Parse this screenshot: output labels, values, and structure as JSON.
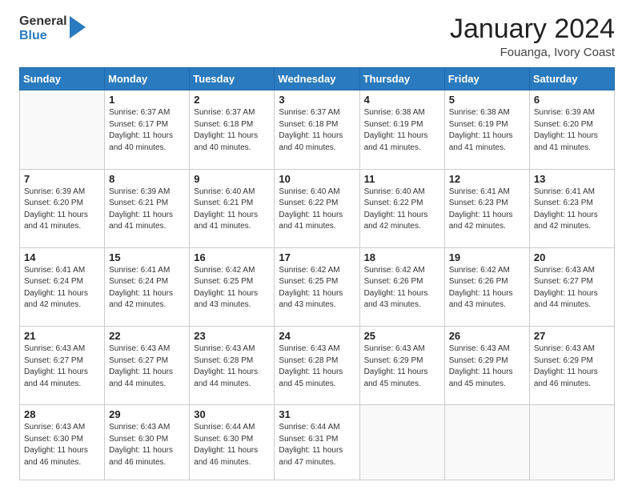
{
  "header": {
    "logo_line1": "General",
    "logo_line2": "Blue",
    "month": "January 2024",
    "location": "Fouanga, Ivory Coast"
  },
  "days_of_week": [
    "Sunday",
    "Monday",
    "Tuesday",
    "Wednesday",
    "Thursday",
    "Friday",
    "Saturday"
  ],
  "weeks": [
    [
      {
        "num": "",
        "info": ""
      },
      {
        "num": "1",
        "info": "Sunrise: 6:37 AM\nSunset: 6:17 PM\nDaylight: 11 hours\nand 40 minutes."
      },
      {
        "num": "2",
        "info": "Sunrise: 6:37 AM\nSunset: 6:18 PM\nDaylight: 11 hours\nand 40 minutes."
      },
      {
        "num": "3",
        "info": "Sunrise: 6:37 AM\nSunset: 6:18 PM\nDaylight: 11 hours\nand 40 minutes."
      },
      {
        "num": "4",
        "info": "Sunrise: 6:38 AM\nSunset: 6:19 PM\nDaylight: 11 hours\nand 41 minutes."
      },
      {
        "num": "5",
        "info": "Sunrise: 6:38 AM\nSunset: 6:19 PM\nDaylight: 11 hours\nand 41 minutes."
      },
      {
        "num": "6",
        "info": "Sunrise: 6:39 AM\nSunset: 6:20 PM\nDaylight: 11 hours\nand 41 minutes."
      }
    ],
    [
      {
        "num": "7",
        "info": "Sunrise: 6:39 AM\nSunset: 6:20 PM\nDaylight: 11 hours\nand 41 minutes."
      },
      {
        "num": "8",
        "info": "Sunrise: 6:39 AM\nSunset: 6:21 PM\nDaylight: 11 hours\nand 41 minutes."
      },
      {
        "num": "9",
        "info": "Sunrise: 6:40 AM\nSunset: 6:21 PM\nDaylight: 11 hours\nand 41 minutes."
      },
      {
        "num": "10",
        "info": "Sunrise: 6:40 AM\nSunset: 6:22 PM\nDaylight: 11 hours\nand 41 minutes."
      },
      {
        "num": "11",
        "info": "Sunrise: 6:40 AM\nSunset: 6:22 PM\nDaylight: 11 hours\nand 42 minutes."
      },
      {
        "num": "12",
        "info": "Sunrise: 6:41 AM\nSunset: 6:23 PM\nDaylight: 11 hours\nand 42 minutes."
      },
      {
        "num": "13",
        "info": "Sunrise: 6:41 AM\nSunset: 6:23 PM\nDaylight: 11 hours\nand 42 minutes."
      }
    ],
    [
      {
        "num": "14",
        "info": "Sunrise: 6:41 AM\nSunset: 6:24 PM\nDaylight: 11 hours\nand 42 minutes."
      },
      {
        "num": "15",
        "info": "Sunrise: 6:41 AM\nSunset: 6:24 PM\nDaylight: 11 hours\nand 42 minutes."
      },
      {
        "num": "16",
        "info": "Sunrise: 6:42 AM\nSunset: 6:25 PM\nDaylight: 11 hours\nand 43 minutes."
      },
      {
        "num": "17",
        "info": "Sunrise: 6:42 AM\nSunset: 6:25 PM\nDaylight: 11 hours\nand 43 minutes."
      },
      {
        "num": "18",
        "info": "Sunrise: 6:42 AM\nSunset: 6:26 PM\nDaylight: 11 hours\nand 43 minutes."
      },
      {
        "num": "19",
        "info": "Sunrise: 6:42 AM\nSunset: 6:26 PM\nDaylight: 11 hours\nand 43 minutes."
      },
      {
        "num": "20",
        "info": "Sunrise: 6:43 AM\nSunset: 6:27 PM\nDaylight: 11 hours\nand 44 minutes."
      }
    ],
    [
      {
        "num": "21",
        "info": "Sunrise: 6:43 AM\nSunset: 6:27 PM\nDaylight: 11 hours\nand 44 minutes."
      },
      {
        "num": "22",
        "info": "Sunrise: 6:43 AM\nSunset: 6:27 PM\nDaylight: 11 hours\nand 44 minutes."
      },
      {
        "num": "23",
        "info": "Sunrise: 6:43 AM\nSunset: 6:28 PM\nDaylight: 11 hours\nand 44 minutes."
      },
      {
        "num": "24",
        "info": "Sunrise: 6:43 AM\nSunset: 6:28 PM\nDaylight: 11 hours\nand 45 minutes."
      },
      {
        "num": "25",
        "info": "Sunrise: 6:43 AM\nSunset: 6:29 PM\nDaylight: 11 hours\nand 45 minutes."
      },
      {
        "num": "26",
        "info": "Sunrise: 6:43 AM\nSunset: 6:29 PM\nDaylight: 11 hours\nand 45 minutes."
      },
      {
        "num": "27",
        "info": "Sunrise: 6:43 AM\nSunset: 6:29 PM\nDaylight: 11 hours\nand 46 minutes."
      }
    ],
    [
      {
        "num": "28",
        "info": "Sunrise: 6:43 AM\nSunset: 6:30 PM\nDaylight: 11 hours\nand 46 minutes."
      },
      {
        "num": "29",
        "info": "Sunrise: 6:43 AM\nSunset: 6:30 PM\nDaylight: 11 hours\nand 46 minutes."
      },
      {
        "num": "30",
        "info": "Sunrise: 6:44 AM\nSunset: 6:30 PM\nDaylight: 11 hours\nand 46 minutes."
      },
      {
        "num": "31",
        "info": "Sunrise: 6:44 AM\nSunset: 6:31 PM\nDaylight: 11 hours\nand 47 minutes."
      },
      {
        "num": "",
        "info": ""
      },
      {
        "num": "",
        "info": ""
      },
      {
        "num": "",
        "info": ""
      }
    ]
  ]
}
